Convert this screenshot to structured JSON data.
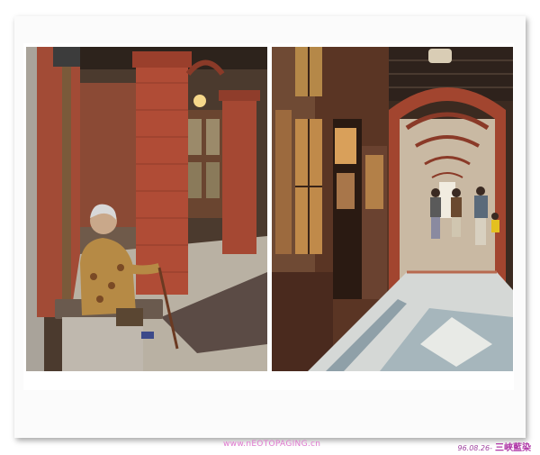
{
  "watermark": {
    "text": "www.nEOTOPAGING.cn"
  },
  "caption": {
    "date": "96.08.26-",
    "place": "三峽藍染"
  }
}
